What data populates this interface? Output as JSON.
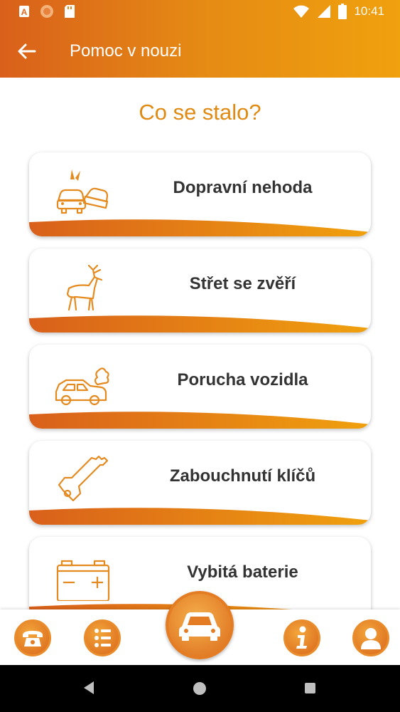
{
  "status_bar": {
    "time": "10:41",
    "icons": [
      "a-notification-icon",
      "circle-notification-icon",
      "sd-card-icon",
      "wifi-icon",
      "signal-icon",
      "battery-icon"
    ]
  },
  "app_bar": {
    "title": "Pomoc v nouzi",
    "back_icon": "arrow-left-icon"
  },
  "headline": "Co se stalo?",
  "options": [
    {
      "label": "Dopravní nehoda",
      "icon": "car-crash-icon"
    },
    {
      "label": "Střet se zvěří",
      "icon": "deer-icon"
    },
    {
      "label": "Porucha vozidla",
      "icon": "broken-car-icon"
    },
    {
      "label": "Zabouchnutí klíčů",
      "icon": "key-icon"
    },
    {
      "label": "Vybitá baterie",
      "icon": "battery-icon"
    }
  ],
  "bottom_nav": [
    "phone-icon",
    "list-icon",
    "car-icon",
    "info-icon",
    "profile-icon"
  ],
  "colors": {
    "accent": "#e08a12",
    "gradient_start": "#d9601b",
    "gradient_end": "#f0a10e",
    "label": "#333333"
  }
}
